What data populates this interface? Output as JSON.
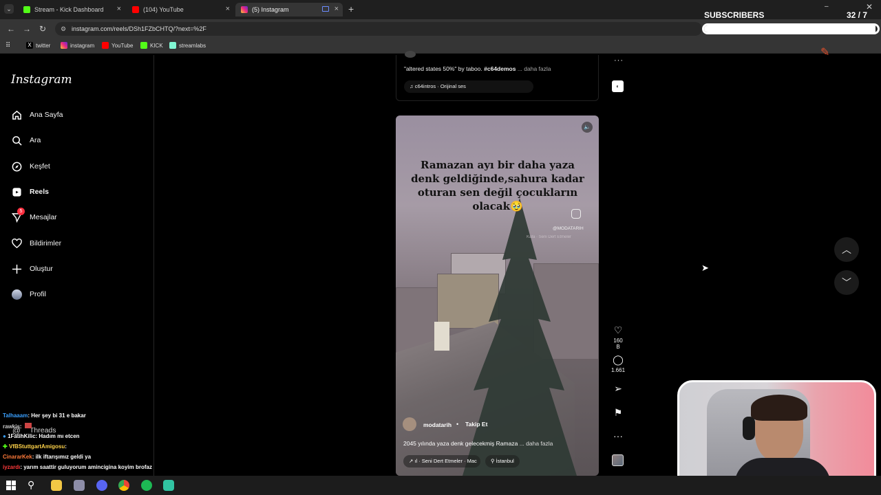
{
  "browser": {
    "tabs": [
      {
        "label": "Stream - Kick Dashboard",
        "color": "#53fc18"
      },
      {
        "label": "(104) YouTube",
        "color": "#ff0000"
      },
      {
        "label": "(5) Instagram",
        "color": "#e1306c"
      }
    ],
    "url": "instagram.com/reels/DSh1FZbCHTQ/?next=%2F",
    "bookmarks": [
      {
        "label": "twitter"
      },
      {
        "label": "instagram"
      },
      {
        "label": "YouTube"
      },
      {
        "label": "KICK"
      },
      {
        "label": "streamlabs"
      }
    ]
  },
  "overlay": {
    "subscribers_label": "SUBSCRIBERS",
    "subscribers_count": "32 / 7",
    "subscribers_progress": 0.99
  },
  "instagram": {
    "logo": "Instagram",
    "nav": [
      {
        "label": "Ana Sayfa",
        "icon": "home-icon"
      },
      {
        "label": "Ara",
        "icon": "search-icon"
      },
      {
        "label": "Keşfet",
        "icon": "compass-icon"
      },
      {
        "label": "Reels",
        "icon": "reels-icon"
      },
      {
        "label": "Mesajlar",
        "icon": "messages-icon",
        "badge": "5"
      },
      {
        "label": "Bildirimler",
        "icon": "heart-icon"
      },
      {
        "label": "Oluştur",
        "icon": "plus-icon"
      },
      {
        "label": "Profil",
        "icon": "avatar-icon"
      },
      {
        "label": "Threads",
        "icon": "threads-icon"
      }
    ],
    "prev_reel": {
      "caption_text": "\"altered states 50%\" by taboo. ",
      "caption_tag": "#c64demos",
      "more": "... daha fazla",
      "audio": "c64intros · Orijinal ses"
    },
    "reel": {
      "overlay_text": "Ramazan ayı bir daha yaza denk geldiğinde,sahura kadar oturan sen değil çocukların olacak🥹",
      "watermark": "@MODATARIH",
      "watermark_sub": "Kafa · Seni Dert Etmeler",
      "username": "modatarih",
      "follow": "Takip Et",
      "caption": "2045 yılında yaza denk gelecekmiş Ramaza",
      "more": "... daha fazla",
      "audio": "ıl · Seni Dert Etmeler · Mac",
      "location": "İstanbul",
      "likes": "160 B",
      "comments": "1.661"
    }
  },
  "chat": [
    {
      "user": "Talhaaam",
      "message": ": Her şey bi 31 e bakar",
      "color": "#3aa0ff"
    },
    {
      "user": "rawkis",
      "message": ": ",
      "color": "#cccccc"
    },
    {
      "user": "1FatihKilic",
      "message": ": Hadım mı etcen",
      "color": "#ffffff"
    },
    {
      "user": "VfBStuttgartAmigosu",
      "message": ": ",
      "color": "#ffd34a"
    },
    {
      "user": "CinararKek",
      "message": ": ilk iftarışımız geldi ya",
      "color": "#ff7a3a"
    },
    {
      "user": "iyzardı",
      "message": ": yarım saattir guluyorum amincigina koyim brofaz",
      "color": "#ff3b3b"
    }
  ]
}
